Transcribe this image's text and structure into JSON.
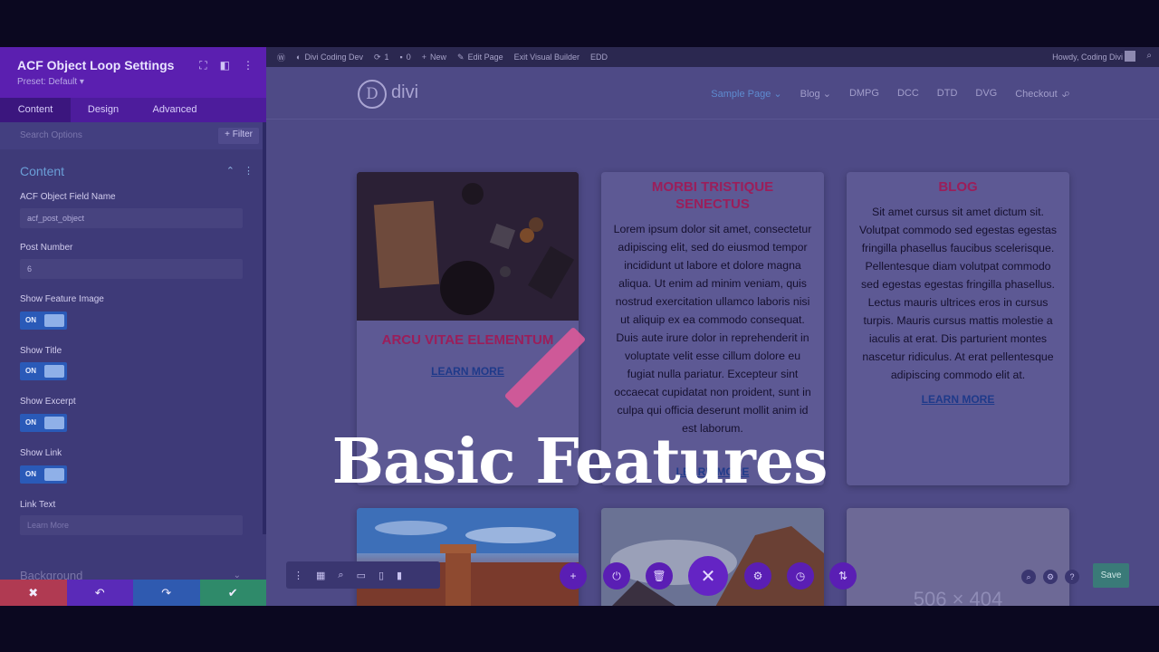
{
  "panel": {
    "title": "ACF Object Loop Settings",
    "preset": "Preset: Default ▾",
    "tabs": [
      "Content",
      "Design",
      "Advanced"
    ],
    "search_placeholder": "Search Options",
    "filter_label": "+ Filter",
    "section_title": "Content",
    "fields": {
      "acf_field_name_label": "ACF Object Field Name",
      "acf_field_name_value": "acf_post_object",
      "post_number_label": "Post Number",
      "post_number_value": "6",
      "show_feature_image_label": "Show Feature Image",
      "show_title_label": "Show Title",
      "show_excerpt_label": "Show Excerpt",
      "show_link_label": "Show Link",
      "link_text_label": "Link Text",
      "link_text_placeholder": "Learn More",
      "toggle_on": "ON"
    },
    "background_section": "Background",
    "action_colors": [
      "#b03a52",
      "#5a2ab8",
      "#2f5ab0",
      "#2f8a6a"
    ]
  },
  "adminbar": {
    "site_name": "Divi Coding Dev",
    "updates": "1",
    "comments": "0",
    "new": "New",
    "edit_page": "Edit Page",
    "exit_builder": "Exit Visual Builder",
    "edd": "EDD",
    "howdy": "Howdy, Coding Divi"
  },
  "site": {
    "logo": "divi",
    "nav": [
      "Sample Page",
      "Blog",
      "DMPG",
      "DCC",
      "DTD",
      "DVG",
      "Checkout"
    ],
    "cards": [
      {
        "title": "ARCU VITAE ELEMENTUM",
        "link": "LEARN MORE"
      },
      {
        "title": "MORBI TRISTIQUE SENECTUS",
        "excerpt": "Lorem ipsum dolor sit amet, consectetur adipiscing elit, sed do eiusmod tempor incididunt ut labore et dolore magna aliqua. Ut enim ad minim veniam, quis nostrud exercitation ullamco laboris nisi ut aliquip ex ea commodo consequat. Duis aute irure dolor in reprehenderit in voluptate velit esse cillum dolore eu fugiat nulla pariatur. Excepteur sint occaecat cupidatat non proident, sunt in culpa qui officia deserunt mollit anim id est laborum.",
        "link": "LEARN MORE"
      },
      {
        "title": "BLOG",
        "excerpt": "Sit amet cursus sit amet dictum sit. Volutpat commodo sed egestas egestas fringilla phasellus faucibus scelerisque. Pellentesque diam volutpat commodo sed egestas egestas fringilla phasellus. Lectus mauris ultrices eros in cursus turpis. Mauris cursus mattis molestie a iaculis at erat. Dis parturient montes nascetur ridiculus. At erat pellentesque adipiscing commodo elit at.",
        "link": "LEARN MORE"
      }
    ],
    "placeholder_size": "506 × 404"
  },
  "toolbar": {
    "save": "Save"
  },
  "overlay": {
    "title": "Basic Features"
  }
}
